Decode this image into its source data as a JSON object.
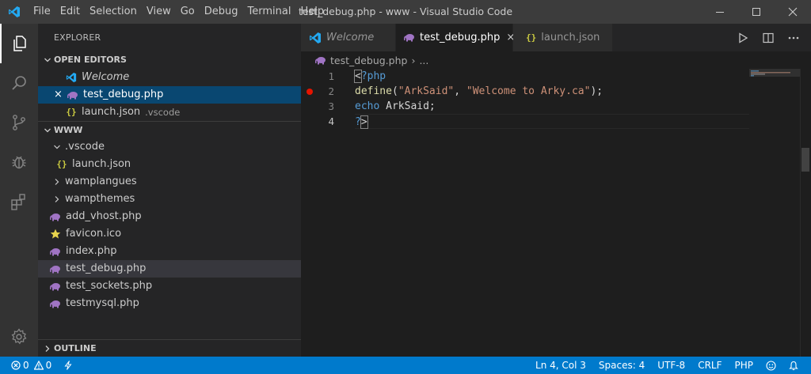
{
  "window": {
    "title": "test_debug.php - www - Visual Studio Code",
    "menu": [
      "File",
      "Edit",
      "Selection",
      "View",
      "Go",
      "Debug",
      "Terminal",
      "Help"
    ],
    "controls": [
      "minimize-icon",
      "maximize-icon",
      "close-icon"
    ]
  },
  "activitybar": {
    "items": [
      "explorer-icon",
      "search-icon",
      "source-control-icon",
      "debug-icon",
      "extensions-icon"
    ],
    "bottom": "settings-gear-icon"
  },
  "sidebar": {
    "title": "EXPLORER",
    "open_editors": {
      "header": "OPEN EDITORS",
      "items": [
        {
          "label": "Welcome",
          "icon": "vscode-icon",
          "italic": true
        },
        {
          "label": "test_debug.php",
          "icon": "php-elephant-icon",
          "selected": true,
          "close": "×"
        },
        {
          "label": "launch.json",
          "icon": "json-braces-icon",
          "desc": ".vscode"
        }
      ]
    },
    "folder": {
      "header": "WWW",
      "items": [
        {
          "label": ".vscode",
          "type": "folder-open",
          "depth": 1
        },
        {
          "label": "launch.json",
          "type": "json",
          "depth": 2
        },
        {
          "label": "wamplangues",
          "type": "folder",
          "depth": 1
        },
        {
          "label": "wampthemes",
          "type": "folder",
          "depth": 1
        },
        {
          "label": "add_vhost.php",
          "type": "php",
          "depth": 1
        },
        {
          "label": "favicon.ico",
          "type": "ico",
          "depth": 1
        },
        {
          "label": "index.php",
          "type": "php",
          "depth": 1
        },
        {
          "label": "test_debug.php",
          "type": "php",
          "depth": 1,
          "active": true
        },
        {
          "label": "test_sockets.php",
          "type": "php",
          "depth": 1
        },
        {
          "label": "testmysql.php",
          "type": "php",
          "depth": 1
        }
      ]
    },
    "outline": {
      "header": "OUTLINE"
    }
  },
  "editor": {
    "tabs": [
      {
        "label": "Welcome",
        "icon": "vscode-icon",
        "italic": true
      },
      {
        "label": "test_debug.php",
        "icon": "php-elephant-icon",
        "active": true,
        "close": "×"
      },
      {
        "label": "launch.json",
        "icon": "json-braces-icon"
      }
    ],
    "actions": [
      "run-icon",
      "split-editor-icon",
      "more-actions-icon"
    ],
    "breadcrumb": {
      "file": "test_debug.php",
      "sep": "›",
      "more": "..."
    },
    "lines": [
      {
        "num": "1",
        "text": "<?php"
      },
      {
        "num": "2",
        "text": "define(\"ArkSaid\", \"Welcome to Arky.ca\");",
        "breakpoint": true
      },
      {
        "num": "3",
        "text": "echo ArkSaid;"
      },
      {
        "num": "4",
        "text": "?>",
        "current": true
      }
    ]
  },
  "statusbar": {
    "errors": "0",
    "warnings": "0",
    "position": "Ln 4, Col 3",
    "spaces": "Spaces: 4",
    "encoding": "UTF-8",
    "eol": "CRLF",
    "language": "PHP",
    "icons": [
      "error-icon",
      "warning-icon",
      "lightning-icon",
      "feedback-smiley-icon",
      "bell-icon"
    ]
  },
  "colors": {
    "accent": "#007acc",
    "selection": "#094771",
    "breakpoint": "#e51400",
    "php_icon": "#a074c4",
    "json_icon": "#cbcb41",
    "favicon_icon": "#e8d44d"
  }
}
